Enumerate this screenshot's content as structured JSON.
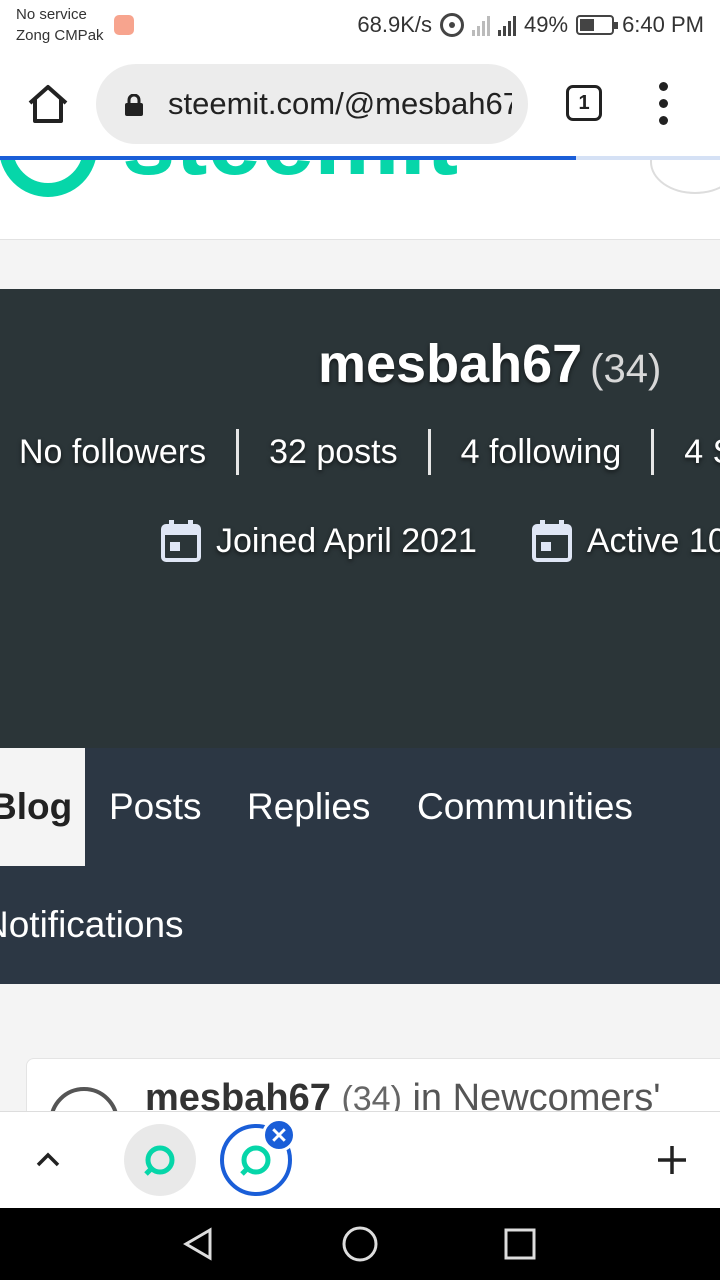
{
  "status_bar": {
    "line1": "No service",
    "line2": "Zong CMPak",
    "net_speed": "68.9K/s",
    "battery": "49%",
    "time": "6:40 PM"
  },
  "browser": {
    "url": "steemit.com/@mesbah67",
    "tab_count": "1",
    "load_progress": 0.8
  },
  "site": {
    "logo_text": "steemit",
    "brand_color": "#06d6a9"
  },
  "profile": {
    "name": "mesbah67",
    "reputation": "(34)",
    "followers": "No followers",
    "posts": "32 posts",
    "following": "4 following",
    "more_stat": "4 S",
    "joined": "Joined April 2021",
    "active": "Active 10"
  },
  "tabs": {
    "blog": "Blog",
    "posts": "Posts",
    "replies": "Replies",
    "communities": "Communities",
    "notifications": "Notifications"
  },
  "post": {
    "author": "mesbah67",
    "reputation": "(34)",
    "community": "in Newcomers'"
  }
}
